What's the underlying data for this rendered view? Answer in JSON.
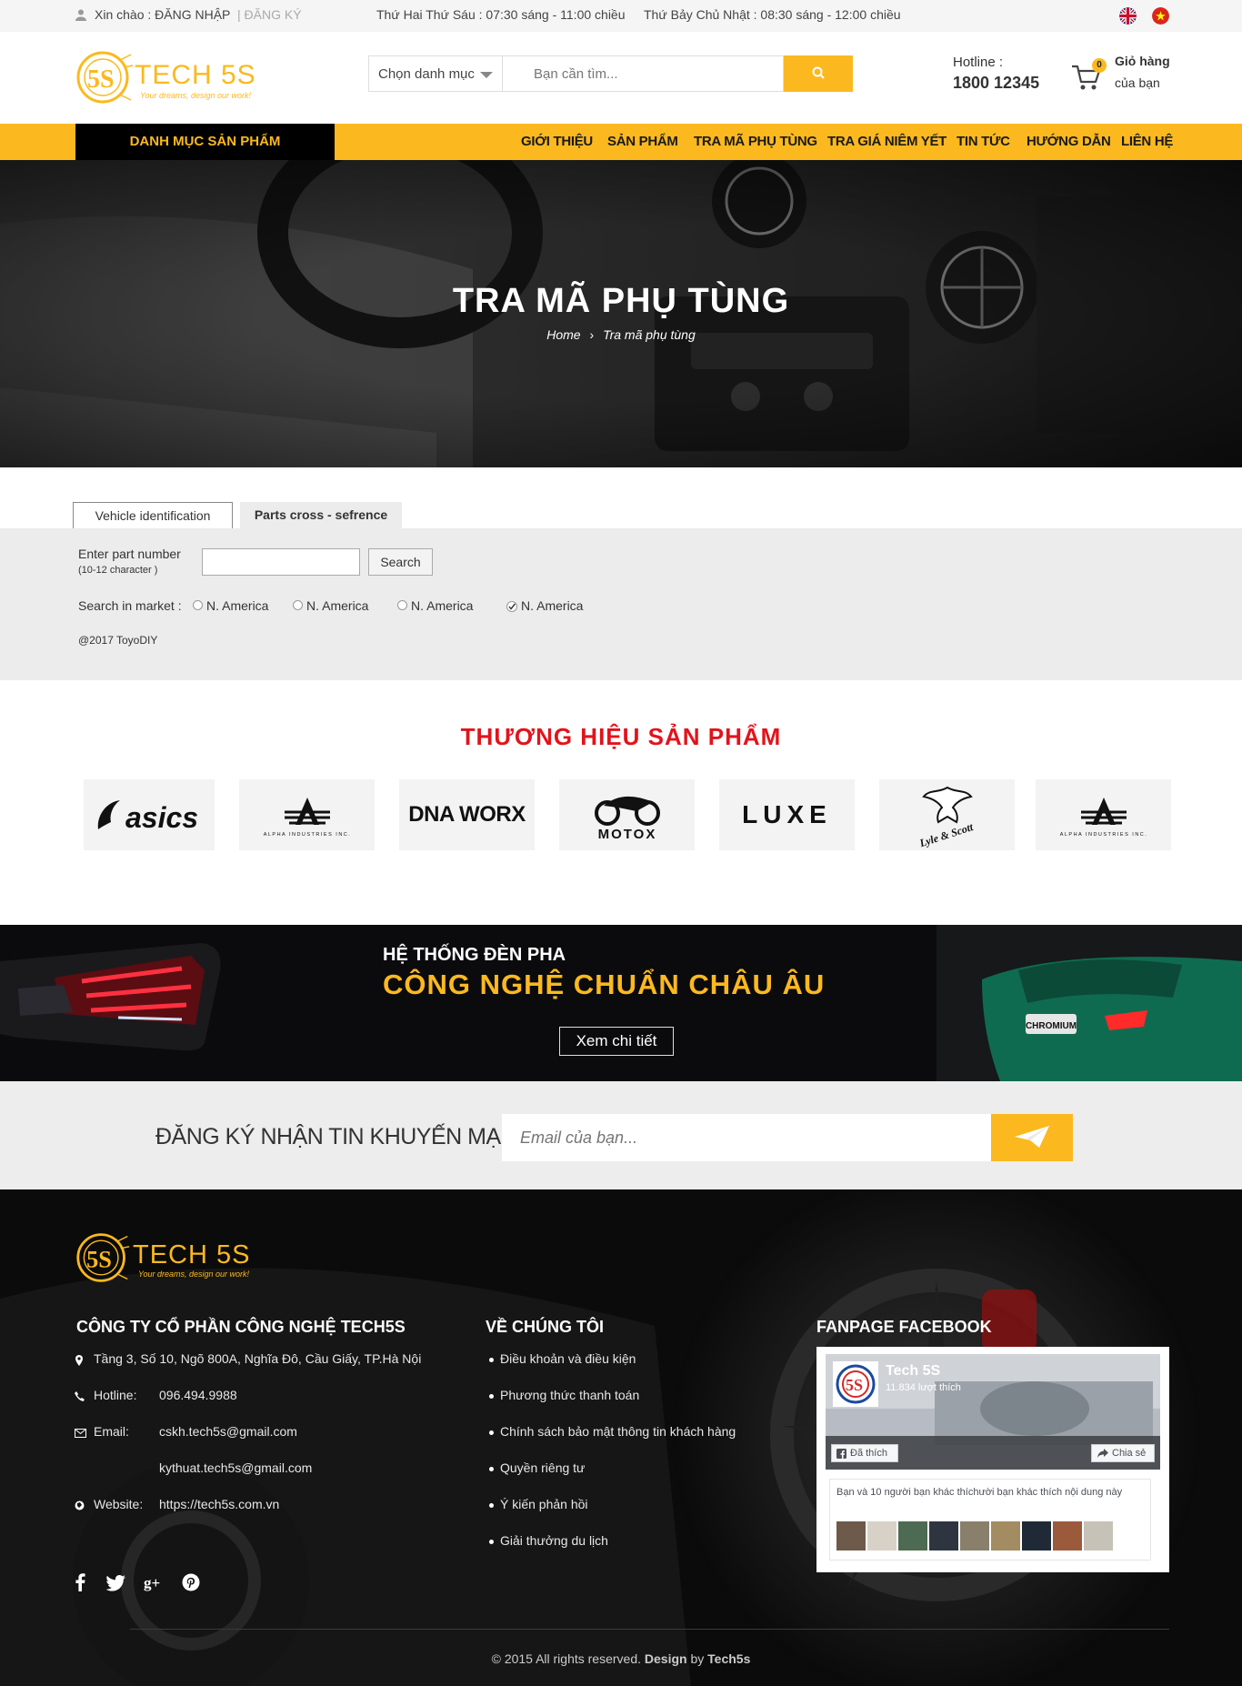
{
  "topbar": {
    "greeting": "Xin chào : ĐĂNG NHẬP",
    "register": "| ĐĂNG KÝ",
    "hours_weekday": "Thứ Hai Thứ Sáu : 07:30 sáng - 11:00 chiều",
    "hours_weekend": "Thứ Bảy Chủ Nhật : 08:30 sáng - 12:00 chiều"
  },
  "header": {
    "logo_text": "TECH 5S",
    "logo_tagline": "Your dreams, design our work!",
    "category_select": "Chọn danh mục",
    "search_placeholder": "Bạn cần tìm...",
    "hotline_label": "Hotline :",
    "hotline_number": "1800 12345",
    "cart_count": "0",
    "cart_label_1": "Giỏ hàng",
    "cart_label_2": "của bạn"
  },
  "nav": {
    "category": "DANH MỤC SẢN PHẨM",
    "items": [
      "GIỚI THIỆU",
      "SẢN PHẨM",
      "TRA MÃ PHỤ TÙNG",
      "TRA GIÁ NIÊM YẾT",
      "TIN TỨC",
      "HƯỚNG DẪN",
      "LIÊN HỆ"
    ]
  },
  "hero": {
    "title": "TRA MÃ PHỤ TÙNG",
    "crumb_home": "Home",
    "crumb_sep": "›",
    "crumb_current": "Tra mã phụ tùng"
  },
  "lookup": {
    "tab_vehicle": "Vehicle identification",
    "tab_parts": "Parts cross - sefrence",
    "part_label": "Enter part number",
    "part_hint": "(10-12 character )",
    "search_button": "Search",
    "market_label": "Search in market :",
    "markets": [
      "N. America",
      "N. America",
      "N. America",
      "N. America"
    ],
    "copyright": "@2017 ToyoDIY"
  },
  "brands": {
    "title": "THƯƠNG HIỆU SẢN PHẨM",
    "items": [
      "asics",
      "ALPHA INDUSTRIES INC.",
      "DNA WORX",
      "MOTOX",
      "LUXE",
      "Lyle & Scott",
      "ALPHA INDUSTRIES INC."
    ]
  },
  "promo": {
    "line1": "HỆ THỐNG ĐÈN PHA",
    "line2": "CÔNG NGHỆ CHUẨN CHÂU ÂU",
    "button": "Xem chi tiết",
    "plate": "CHROMIUM"
  },
  "newsletter": {
    "title": "ĐĂNG KÝ NHẬN TIN KHUYẾN MẠI",
    "placeholder": "Email của bạn..."
  },
  "footer": {
    "company_title": "CÔNG TY CỔ PHẦN CÔNG NGHỆ TECH5S",
    "address": "Tầng 3, Số 10, Ngõ 800A, Nghĩa Đô, Cầu Giấy, TP.Hà Nội",
    "hotline_label": "Hotline:",
    "hotline": "096.494.9988",
    "email_label": "Email:",
    "email1": "cskh.tech5s@gmail.com",
    "email2": "kythuat.tech5s@gmail.com",
    "website_label": "Website:",
    "website": "https://tech5s.com.vn",
    "about_title": "VỀ CHÚNG TÔI",
    "about_links": [
      "Điều khoản và điều kiện",
      "Phương thức thanh toán",
      "Chính sách bảo mật thông tin khách hàng",
      "Quyền riêng tư",
      "Ý kiến phản hồi",
      "Giải thưởng du lịch"
    ],
    "fanpage_title": "FANPAGE FACEBOOK",
    "fb_page_name": "Tech 5S",
    "fb_likes": "11.834 lượt thích",
    "fb_liked": "Đã thích",
    "fb_share": "Chia sẻ",
    "fb_friends": "Bạn và 10 người bạn khác thíchười bạn khác thích nội dung này",
    "copyright_prefix": "© 2015 All rights reserved.",
    "copyright_design": "Design",
    "copyright_by": "by",
    "copyright_brand": "Tech5s"
  },
  "colors": {
    "accent": "#fbb91f",
    "brand_red": "#e3131b",
    "dark": "#0a0a0a"
  }
}
